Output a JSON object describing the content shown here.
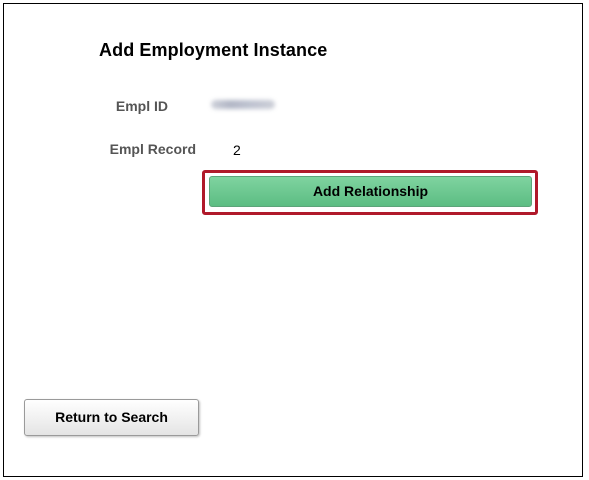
{
  "page": {
    "title": "Add Employment Instance"
  },
  "fields": {
    "empl_id_label": "Empl ID",
    "empl_record_label": "Empl Record",
    "empl_record_value": "2"
  },
  "actions": {
    "add_relationship_label": "Add Relationship",
    "return_to_search_label": "Return to Search"
  },
  "colors": {
    "accent_green": "#6cc892",
    "highlight_red": "#b0192a"
  }
}
